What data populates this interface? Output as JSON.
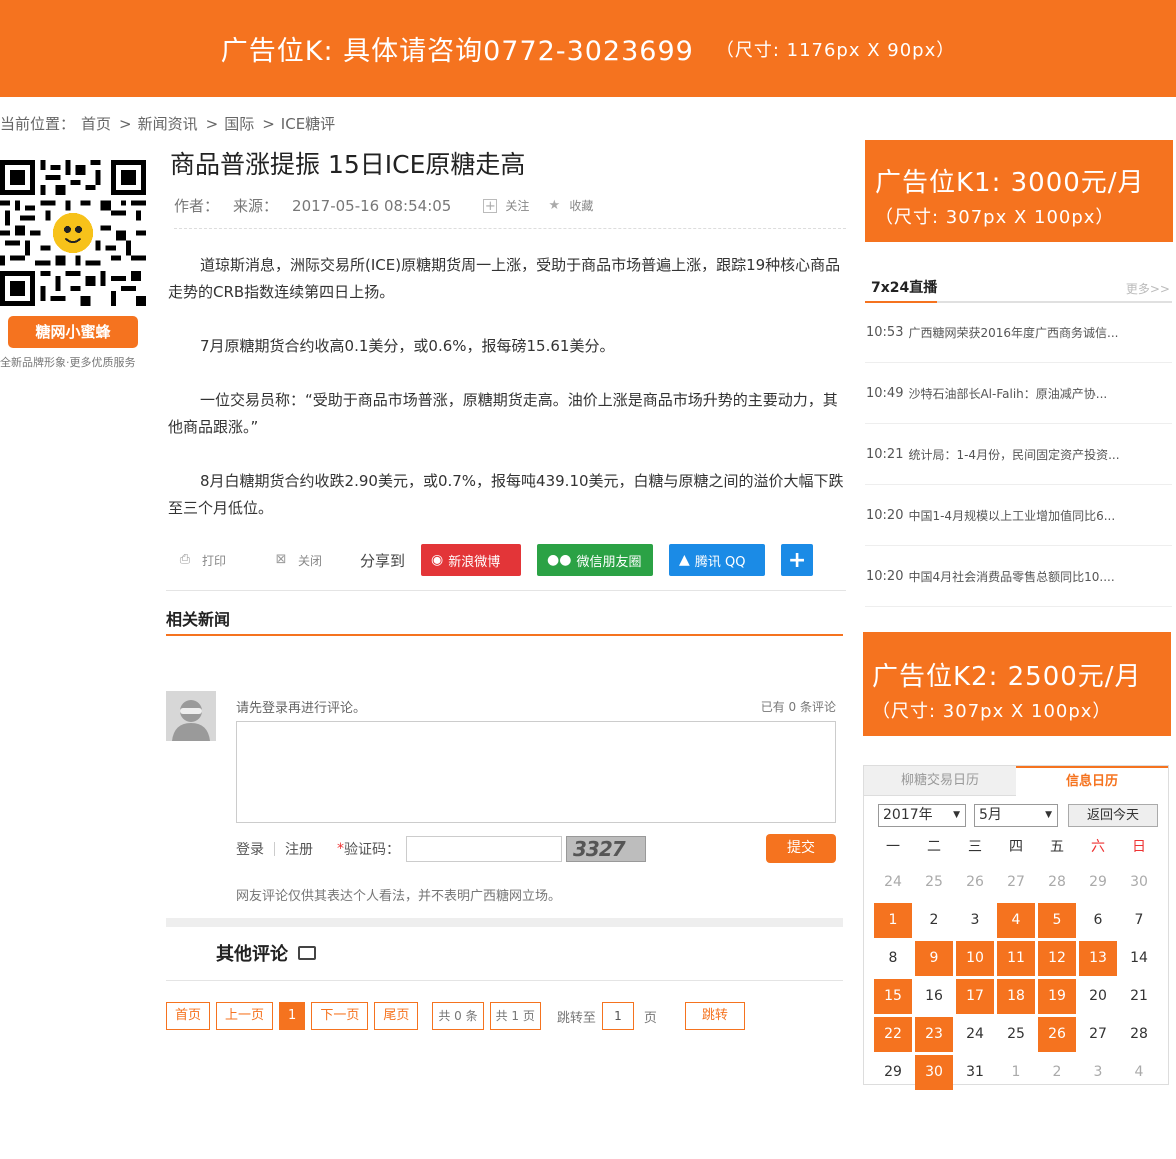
{
  "top_ad": {
    "main": "广告位K: 具体请咨询0772-3023699",
    "sub": "（尺寸: 1176px X 90px）"
  },
  "breadcrumb": {
    "label": "当前位置：",
    "items": [
      "首页",
      "新闻资讯",
      "国际",
      "ICE糖评"
    ],
    "sep": ">"
  },
  "qr": {
    "button": "糖网小蜜蜂",
    "caption": "全新品牌形象·更多优质服务"
  },
  "article": {
    "title": "商品普涨提振 15日ICE原糖走高",
    "author_label": "作者：",
    "source_label": "来源：",
    "datetime": "2017-05-16 08:54:05",
    "follow": "关注",
    "favorite": "收藏",
    "paragraphs": [
      "道琼斯消息，洲际交易所(ICE)原糖期货周一上涨，受助于商品市场普遍上涨，跟踪19种核心商品走势的CRB指数连续第四日上扬。",
      "7月原糖期货合约收高0.1美分，或0.6%，报每磅15.61美分。",
      "一位交易员称：“受助于商品市场普涨，原糖期货走高。油价上涨是商品市场升势的主要动力，其他商品跟涨。”",
      "8月白糖期货合约收跌2.90美元，或0.7%，报每吨439.10美元，白糖与原糖之间的溢价大幅下跌至三个月低位。"
    ]
  },
  "tools": {
    "print": "打印",
    "close": "关闭",
    "share_label": "分享到",
    "weibo": "新浪微博",
    "wechat": "微信朋友圈",
    "qq": "腾讯 QQ",
    "plus": "+"
  },
  "related": {
    "title": "相关新闻"
  },
  "comment": {
    "login_hint": "请先登录再进行评论。",
    "count": "已有 0 条评论",
    "login": "登录",
    "register": "注册",
    "captcha_label": "验证码：",
    "captcha_text": "3327",
    "submit": "提交",
    "disclaimer": "网友评论仅供其表达个人看法，并不表明广西糖网立场。"
  },
  "other": {
    "title": "其他评论"
  },
  "pager": {
    "first": "首页",
    "prev": "上一页",
    "current": "1",
    "next": "下一页",
    "last": "尾页",
    "total_items": "共 0 条",
    "total_pages": "共 1 页",
    "jump_label": "跳转至",
    "jump_value": "1",
    "page_unit": "页",
    "go": "跳转"
  },
  "ad_k1": {
    "big": "广告位K1: 3000元/月",
    "small": "（尺寸: 307px X 100px）"
  },
  "live": {
    "title": "7x24直播",
    "more": "更多>>",
    "items": [
      {
        "time": "10:53",
        "text": "广西糖网荣获2016年度广西商务诚信..."
      },
      {
        "time": "10:49",
        "text": "沙特石油部长Al-Falih：原油减产协..."
      },
      {
        "time": "10:21",
        "text": "统计局：1-4月份，民间固定资产投资..."
      },
      {
        "time": "10:20",
        "text": "中国1-4月规模以上工业增加值同比6..."
      },
      {
        "time": "10:20",
        "text": "中国4月社会消费品零售总额同比10...."
      }
    ]
  },
  "ad_k2": {
    "big": "广告位K2: 2500元/月",
    "small": "（尺寸: 307px X 100px）"
  },
  "calendar": {
    "tabs": [
      "柳糖交易日历",
      "信息日历"
    ],
    "year": "2017年",
    "month": "5月",
    "today": "返回今天",
    "weekdays": [
      "一",
      "二",
      "三",
      "四",
      "五",
      "六",
      "日"
    ],
    "rows": [
      [
        [
          "24",
          "dim"
        ],
        [
          "25",
          "dim"
        ],
        [
          "26",
          "dim"
        ],
        [
          "27",
          "dim"
        ],
        [
          "28",
          "dim"
        ],
        [
          "29",
          "dim"
        ],
        [
          "30",
          "dim"
        ]
      ],
      [
        [
          "1",
          "hl"
        ],
        [
          "2",
          ""
        ],
        [
          "3",
          ""
        ],
        [
          "4",
          "hl"
        ],
        [
          "5",
          "hl"
        ],
        [
          "6",
          ""
        ],
        [
          "7",
          ""
        ]
      ],
      [
        [
          "8",
          ""
        ],
        [
          "9",
          "hl"
        ],
        [
          "10",
          "hl"
        ],
        [
          "11",
          "hl"
        ],
        [
          "12",
          "hl"
        ],
        [
          "13",
          "hl"
        ],
        [
          "14",
          ""
        ]
      ],
      [
        [
          "15",
          "hl"
        ],
        [
          "16",
          ""
        ],
        [
          "17",
          "hl"
        ],
        [
          "18",
          "hl"
        ],
        [
          "19",
          "hl"
        ],
        [
          "20",
          ""
        ],
        [
          "21",
          ""
        ]
      ],
      [
        [
          "22",
          "hl"
        ],
        [
          "23",
          "hl"
        ],
        [
          "24",
          ""
        ],
        [
          "25",
          ""
        ],
        [
          "26",
          "hl"
        ],
        [
          "27",
          ""
        ],
        [
          "28",
          ""
        ]
      ],
      [
        [
          "29",
          ""
        ],
        [
          "30",
          "hl"
        ],
        [
          "31",
          ""
        ],
        [
          "1",
          "dim"
        ],
        [
          "2",
          "dim"
        ],
        [
          "3",
          "dim"
        ],
        [
          "4",
          "dim"
        ]
      ]
    ]
  }
}
